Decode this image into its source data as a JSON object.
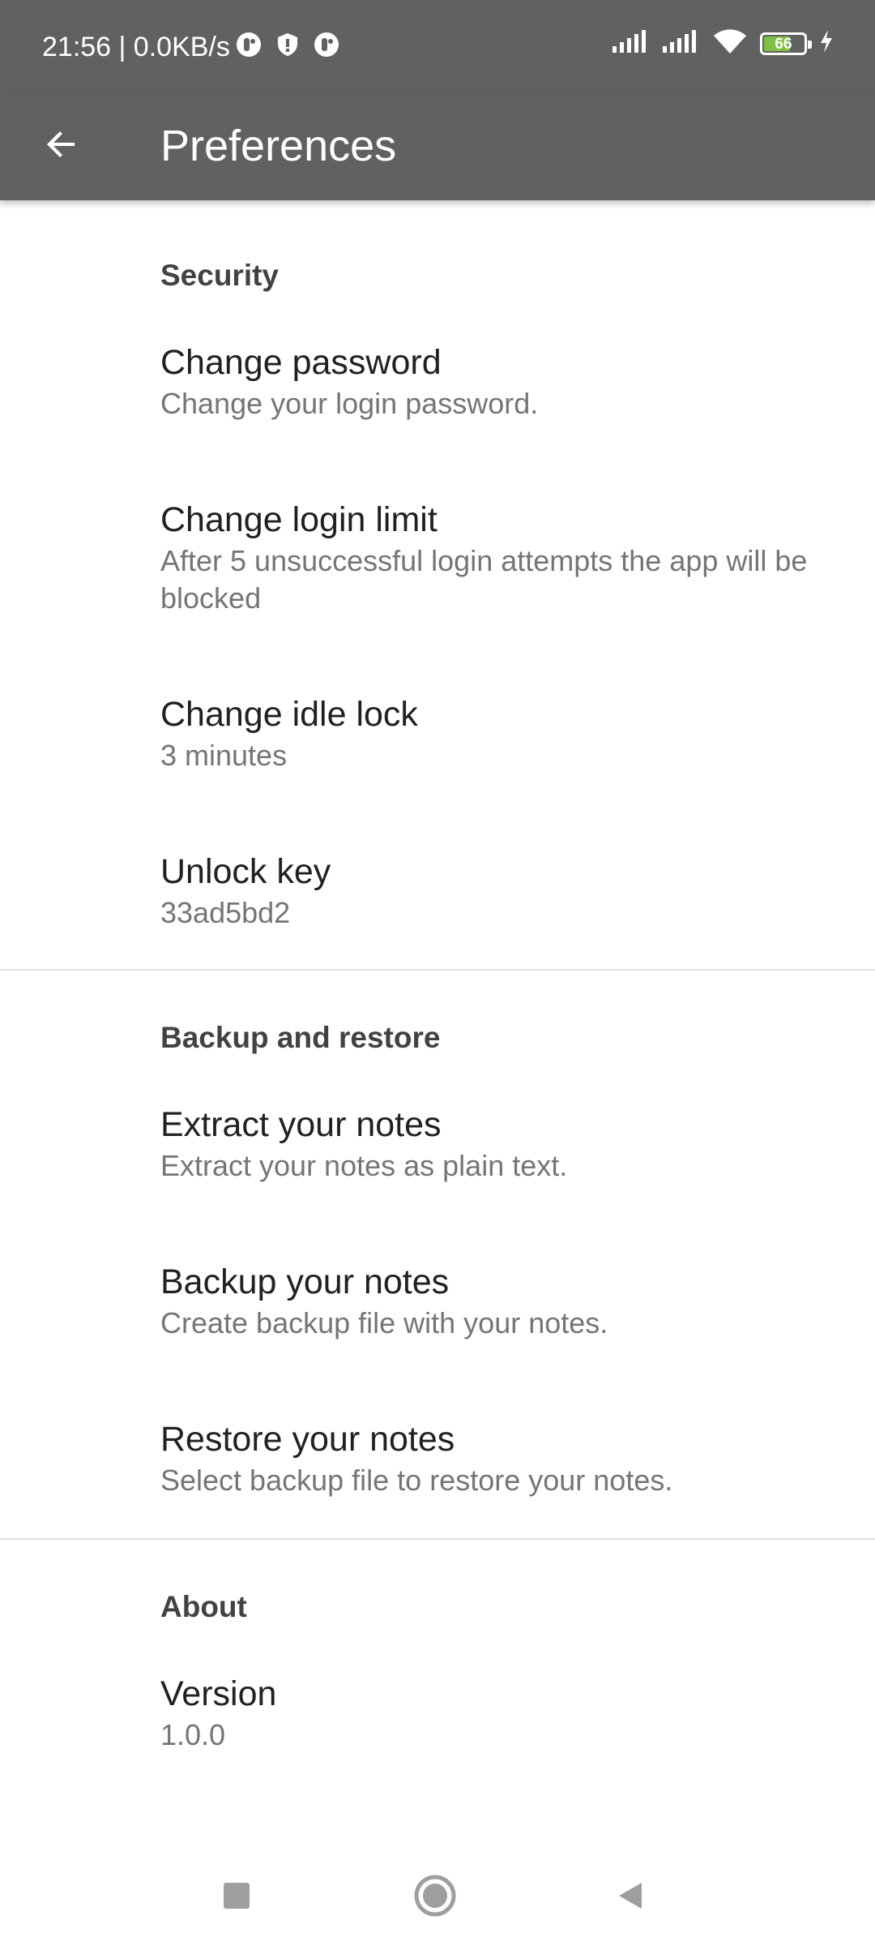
{
  "status_bar": {
    "time": "21:56 | 0.0KB/s",
    "battery_level": "66",
    "battery_fraction": 0.66,
    "icons_left": [
      "app-notification-icon",
      "shield-icon",
      "app-notification-icon"
    ],
    "icons_right": [
      "signal-icon",
      "signal-icon",
      "wifi-icon",
      "battery-icon",
      "charging-icon"
    ]
  },
  "app_bar": {
    "title": "Preferences",
    "background": "#616161"
  },
  "sections": {
    "security": {
      "header": "Security",
      "change_password": {
        "title": "Change password",
        "summary": "Change your login password."
      },
      "change_login_limit": {
        "title": "Change login limit",
        "summary": "After 5 unsuccessful login attempts the app will be blocked"
      },
      "change_idle_lock": {
        "title": "Change idle lock",
        "summary": "3 minutes"
      },
      "unlock_key": {
        "title": "Unlock key",
        "summary": "33ad5bd2"
      }
    },
    "backup": {
      "header": "Backup and restore",
      "extract": {
        "title": "Extract your notes",
        "summary": "Extract your notes as plain text."
      },
      "backup": {
        "title": "Backup your notes",
        "summary": "Create backup file with your notes."
      },
      "restore": {
        "title": "Restore your notes",
        "summary": "Select backup file to restore your notes."
      }
    },
    "about": {
      "header": "About",
      "version": {
        "title": "Version",
        "summary": "1.0.0"
      }
    }
  },
  "nav_bar": {
    "icons": [
      "recents-square-icon",
      "home-circle-icon",
      "back-triangle-icon"
    ]
  }
}
